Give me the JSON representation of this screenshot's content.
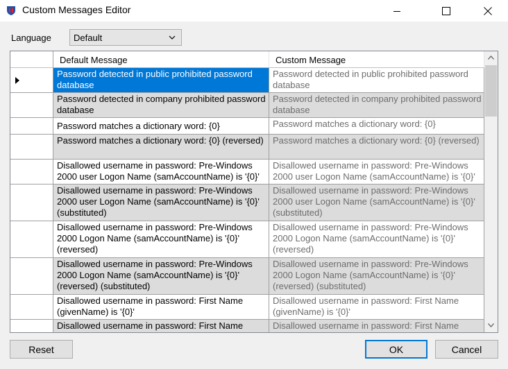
{
  "window": {
    "title": "Custom Messages Editor"
  },
  "language": {
    "label": "Language",
    "selected": "Default"
  },
  "grid": {
    "columns": [
      "Default Message",
      "Custom Message"
    ],
    "rows": [
      {
        "default": "Password detected in public prohibited password database",
        "custom": "Password detected in public prohibited password database",
        "selected": true
      },
      {
        "default": "Password detected in company prohibited password database",
        "custom": "Password detected in company prohibited password database"
      },
      {
        "default": "Password matches a dictionary word: {0}",
        "custom": "Password matches a dictionary word: {0}"
      },
      {
        "default": "Password matches a dictionary word: {0} (reversed)",
        "custom": "Password matches a dictionary word: {0} (reversed)"
      },
      {
        "default": "Disallowed username in password: Pre-Windows 2000 user Logon Name (samAccountName) is '{0}'",
        "custom": "Disallowed username in password: Pre-Windows 2000 user Logon Name (samAccountName) is '{0}'"
      },
      {
        "default": "Disallowed username in password: Pre-Windows 2000 user Logon Name (samAccountName) is '{0}' (substituted)",
        "custom": "Disallowed username in password: Pre-Windows 2000 user Logon Name (samAccountName) is '{0}' (substituted)"
      },
      {
        "default": "Disallowed username in password: Pre-Windows 2000 Logon Name (samAccountName) is '{0}' (reversed)",
        "custom": "Disallowed username in password: Pre-Windows 2000 Logon Name (samAccountName) is '{0}' (reversed)"
      },
      {
        "default": "Disallowed username in password: Pre-Windows 2000 Logon Name (samAccountName) is '{0}' (reversed) (substituted)",
        "custom": "Disallowed username in password: Pre-Windows 2000 Logon Name (samAccountName) is '{0}' (reversed) (substituted)"
      },
      {
        "default": "Disallowed username in password: First Name (givenName) is '{0}'",
        "custom": "Disallowed username in password: First Name (givenName) is '{0}'"
      },
      {
        "default": "Disallowed username in password: First Name",
        "custom": "Disallowed username in password: First Name"
      }
    ]
  },
  "buttons": {
    "reset": "Reset",
    "ok": "OK",
    "cancel": "Cancel"
  }
}
